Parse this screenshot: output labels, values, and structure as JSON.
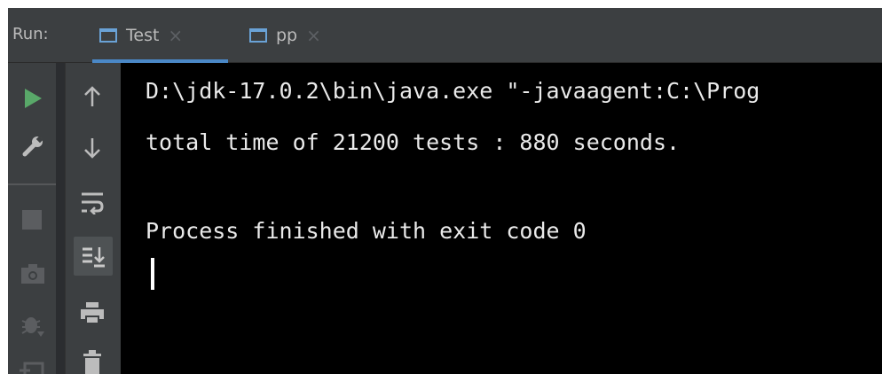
{
  "run_panel": {
    "label": "Run:",
    "tabs": [
      {
        "title": "Test",
        "close": "×",
        "active": true
      },
      {
        "title": "pp",
        "close": "×",
        "active": false
      }
    ]
  },
  "toolbar": {
    "left": [
      "run-icon",
      "wrench-icon",
      "stop-icon",
      "camera-icon",
      "bug-icon",
      "restore-layout-icon"
    ],
    "right": [
      "up-arrow-icon",
      "down-arrow-icon",
      "soft-wrap-icon",
      "scroll-to-end-icon",
      "print-icon",
      "trash-icon"
    ]
  },
  "console": {
    "lines": [
      "D:\\jdk-17.0.2\\bin\\java.exe \"-javaagent:C:\\Prog",
      "total time of 21200 tests : 880 seconds.",
      "",
      "Process finished with exit code 0"
    ]
  },
  "colors": {
    "accent": "#4a88c7",
    "run_green": "#59a869",
    "console_bg": "#000000",
    "console_text": "#eaeaea"
  }
}
